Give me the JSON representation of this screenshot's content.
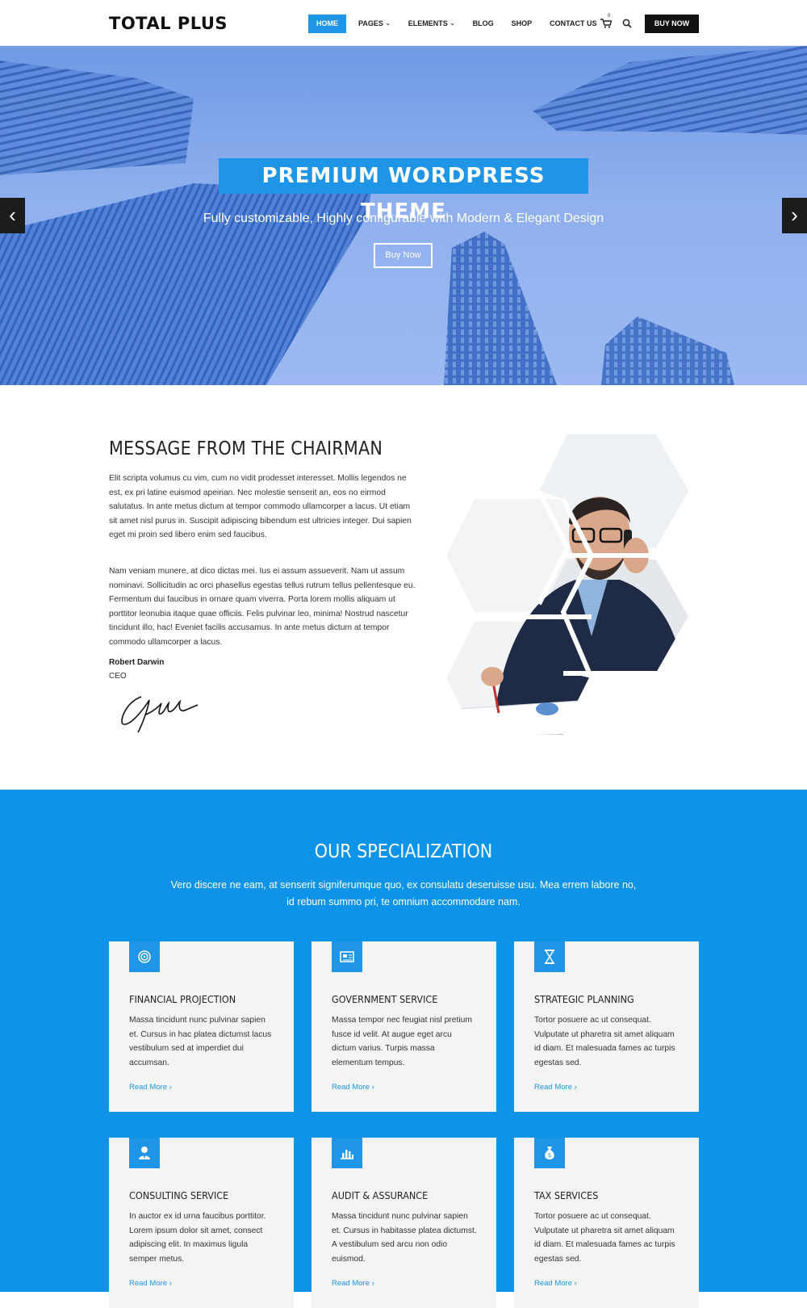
{
  "header": {
    "logo": "TOTAL PLUS",
    "nav": [
      {
        "label": "HOME",
        "active": true,
        "dropdown": false
      },
      {
        "label": "PAGES",
        "active": false,
        "dropdown": true
      },
      {
        "label": "ELEMENTS",
        "active": false,
        "dropdown": true
      },
      {
        "label": "BLOG",
        "active": false,
        "dropdown": false
      },
      {
        "label": "SHOP",
        "active": false,
        "dropdown": false
      },
      {
        "label": "CONTACT US",
        "active": false,
        "dropdown": false
      }
    ],
    "cart_count": "0",
    "cart_icon": "cart-icon",
    "search_icon": "search-icon",
    "buy_label": "BUY NOW"
  },
  "hero": {
    "title": "PREMIUM WORDPRESS THEME",
    "subtitle": "Fully customizable, Highly configurable with Modern & Elegant Design",
    "button": "Buy Now",
    "prev_icon": "chevron-left-icon",
    "next_icon": "chevron-right-icon"
  },
  "chairman": {
    "title": "MESSAGE FROM THE CHAIRMAN",
    "para1": "Elit scripta volumus cu vim, cum no vidit prodesset interesset. Mollis legendos ne est, ex pri latine euismod apeirian. Nec molestie senserit an, eos no eirmod salutatus. In ante metus dictum at tempor commodo ullamcorper a lacus. Ut etiam sit amet nisl purus in. Suscipit adipiscing bibendum est ultricies integer. Dui sapien eget mi proin sed libero enim sed faucibus.",
    "para2": "Nam veniam munere, at dico dictas mei. Ius ei assum assueverit. Nam ut assum nominavi. Sollicitudin ac orci phasellus egestas tellus rutrum tellus pellentesque eu. Fermentum dui faucibus in ornare quam viverra. Porta lorem mollis aliquam ut porttitor leonubia itaque quae officiis. Felis pulvinar leo, minima! Nostrud nascetur tincidunt illo, hac! Eveniet facilis accusamus. In ante metus dictum at tempor commodo ullamcorper a lacus.",
    "name": "Robert Darwin",
    "role": "CEO"
  },
  "specialization": {
    "title": "OUR SPECIALIZATION",
    "description": "Vero discere ne eam, at senserit signiferumque quo, ex consulatu deseruisse usu. Mea errem labore no, id rebum summo pri, te omnium accommodare nam.",
    "cards": [
      {
        "icon": "target-icon",
        "title": "FINANCIAL PROJECTION",
        "text": "Massa tincidunt nunc pulvinar sapien et. Cursus in hac platea dictumst lacus vestibulum sed at imperdiet dui accumsan.",
        "link": "Read More"
      },
      {
        "icon": "newspaper-icon",
        "title": "GOVERNMENT SERVICE",
        "text": "Massa tempor nec feugiat nisl pretium fusce id velit. At augue eget arcu dictum varius. Turpis massa elementum tempus.",
        "link": "Read More"
      },
      {
        "icon": "hourglass-icon",
        "title": "STRATEGIC PLANNING",
        "text": "Tortor posuere ac ut consequat. Vulputate ut pharetra sit amet aliquam id diam. Et malesuada fames ac turpis egestas sed.",
        "link": "Read More"
      },
      {
        "icon": "user-tie-icon",
        "title": "CONSULTING SERVICE",
        "text": "In auctor ex id urna faucibus porttitor. Lorem ipsum dolor sit amet, consect adipiscing elit. In maximus ligula semper metus.",
        "link": "Read More"
      },
      {
        "icon": "bar-chart-icon",
        "title": "AUDIT & ASSURANCE",
        "text": "Massa tincidunt nunc pulvinar sapien et. Cursus in habitasse platea dictumst. A vestibulum sed arcu non odio euismod.",
        "link": "Read More"
      },
      {
        "icon": "money-bag-icon",
        "title": "TAX SERVICES",
        "text": "Tortor posuere ac ut consequat. Vulputate ut pharetra sit amet aliquam id diam. Et malesuada fames ac turpis egestas sed.",
        "link": "Read More"
      }
    ]
  },
  "colors": {
    "accent": "#1e95e6",
    "section_bg": "#0d93e8",
    "dark": "#111111"
  }
}
